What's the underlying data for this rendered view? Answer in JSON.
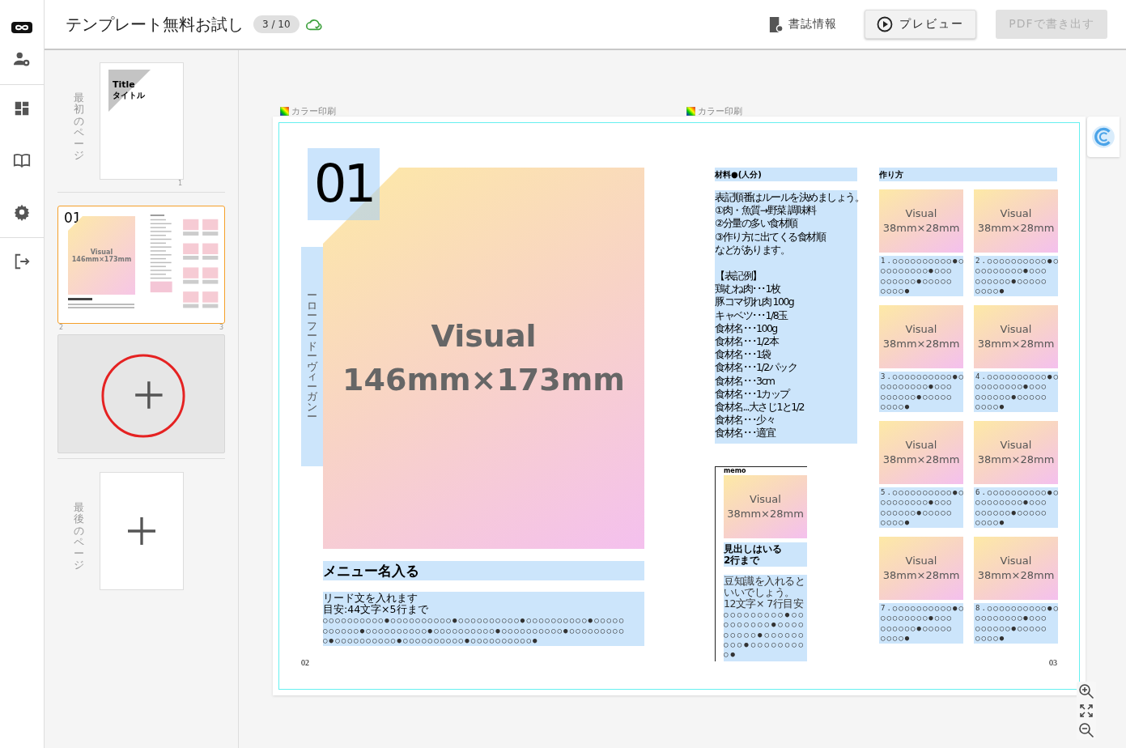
{
  "header": {
    "title": "テンプレート無料お試し",
    "page_counter": "3 / 10",
    "saved": true
  },
  "toolbar": {
    "info": "書誌情報",
    "preview": "プレビュー",
    "export": {
      "label": "PDFで書き出す",
      "disabled": true
    }
  },
  "pages_panel": {
    "first_label": "最初のページ",
    "first_page": {
      "number": "1",
      "title": "Title",
      "subtitle": "タイトル"
    },
    "spread": {
      "selected": true,
      "number": "01",
      "visual": [
        "Visual",
        "146mm×173mm"
      ],
      "left_number": "2",
      "right_number": "3"
    },
    "last_label": "最後のページ"
  },
  "spread": {
    "print_labels": [
      "カラー印刷",
      "カラー印刷"
    ],
    "left_page": {
      "number": "01",
      "visual": [
        "Visual",
        "146mm×173mm"
      ],
      "tags": "ーローフードーヴィーガンー",
      "menu_title": "メニュー名入る",
      "lead": [
        "リード文を入れます",
        "目安:44文字×5行まで",
        "○○○○○○○○○○●○○○○○○○○○○●○○○○○○○○○○●○○○○○○○○○○●○○○○○",
        "○○○○○○●○○○○○○○○○○●○○○○○○○○○○●○○○○○○○○○○●○○○○○○○○○",
        "○●○○○○○○○○○○●○○○○○○○○○○●○○○○○○○○○○●"
      ],
      "page_number": "02"
    },
    "right_page": {
      "ingredients_title": "材料●(人分)",
      "ingredient_notes": [
        "表記順番はルールを決めましょう。",
        "①肉・魚質→野菜 調味料",
        "②分量の多い食材順",
        "③作り方に出てくる食材順",
        "などがあります。"
      ],
      "ingredients": [
        "【表記例】",
        "鶏むね肉･･･1枚",
        "豚コマ切れ肉 100g",
        "キャベツ･･･1/8玉",
        "食材名･･･100g",
        "食材名･･･1/2本",
        "食材名･･･1袋",
        "食材名･･･1/2パック",
        "食材名･･･3cm",
        "食材名･･･1カップ",
        "食材名...大さじ1と1/2",
        "食材名･･･少々",
        "食材名･･･適宜"
      ],
      "memo": {
        "label": "memo",
        "visual": [
          "Visual",
          "38mm×28mm"
        ],
        "heading": [
          "見出しはいる",
          "2行まで"
        ],
        "text": "豆知識を入れるといいでしょう。 12文字× 7行目安",
        "dots": [
          "○○○○○○○○○●○○",
          "○○○○○○○●○○○○",
          "○○○○○●○○○○○○",
          "○○○●○○○○○○○○",
          "○●"
        ]
      },
      "steps_title": "作り方",
      "steps": [
        {
          "visual": [
            "Visual",
            "38mm×28mm"
          ],
          "lines": [
            "1.○○○○○○○○○○●○",
            "○○○○○○○○●○○○",
            "○○○○○○●○○○○○",
            "○○○○●"
          ]
        },
        {
          "visual": [
            "Visual",
            "38mm×28mm"
          ],
          "lines": [
            "2.○○○○○○○○○○●○",
            "○○○○○○○○●○○○",
            "○○○○○○●○○○○○",
            "○○○○●"
          ]
        },
        {
          "visual": [
            "Visual",
            "38mm×28mm"
          ],
          "lines": [
            "3.○○○○○○○○○○●○",
            "○○○○○○○○●○○○",
            "○○○○○○●○○○○○",
            "○○○○●"
          ]
        },
        {
          "visual": [
            "Visual",
            "38mm×28mm"
          ],
          "lines": [
            "4.○○○○○○○○○○●○",
            "○○○○○○○○●○○○",
            "○○○○○○●○○○○○",
            "○○○○●"
          ]
        },
        {
          "visual": [
            "Visual",
            "38mm×28mm"
          ],
          "lines": [
            "5.○○○○○○○○○○●○",
            "○○○○○○○○●○○○",
            "○○○○○○●○○○○○",
            "○○○○●"
          ]
        },
        {
          "visual": [
            "Visual",
            "38mm×28mm"
          ],
          "lines": [
            "6.○○○○○○○○○○●○",
            "○○○○○○○○●○○○",
            "○○○○○○●○○○○○",
            "○○○○●"
          ]
        },
        {
          "visual": [
            "Visual",
            "38mm×28mm"
          ],
          "lines": [
            "7.○○○○○○○○○○●○",
            "○○○○○○○○●○○○",
            "○○○○○○●○○○○○",
            "○○○○●"
          ]
        },
        {
          "visual": [
            "Visual",
            "38mm×28mm"
          ],
          "lines": [
            "8.○○○○○○○○○○●○",
            "○○○○○○○○●○○○",
            "○○○○○○●○○○○○",
            "○○○○●"
          ]
        }
      ],
      "page_number": "03"
    }
  }
}
